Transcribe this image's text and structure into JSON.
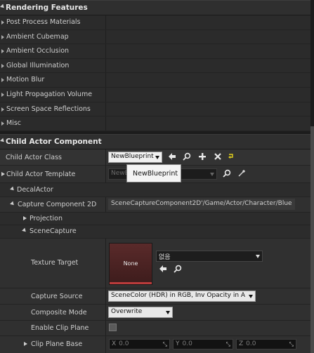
{
  "rendering_features": {
    "header": "Rendering Features",
    "items": [
      "Post Process Materials",
      "Ambient Cubemap",
      "Ambient Occlusion",
      "Global Illumination",
      "Motion Blur",
      "Light Propagation Volume",
      "Screen Space Reflections",
      "Misc"
    ]
  },
  "child_actor_component": {
    "header": "Child Actor Component",
    "child_actor_class": {
      "label": "Child Actor Class",
      "value": "NewBlueprint"
    },
    "child_actor_template": {
      "label": "Child Actor Template",
      "value": "NewB"
    },
    "tooltip": "NewBlueprint",
    "decal_actor": {
      "label": "DecalActor"
    },
    "capture_component": {
      "label": "Capture Component 2D",
      "value": "SceneCaptureComponent2D'/Game/Actor/Character/Blue"
    },
    "projection": {
      "label": "Projection"
    },
    "scene_capture": {
      "label": "SceneCapture"
    },
    "texture_target": {
      "label": "Texture Target",
      "thumbnail": "None",
      "value": "없음"
    },
    "capture_source": {
      "label": "Capture Source",
      "value": "SceneColor (HDR) in RGB, Inv Opacity in A"
    },
    "composite_mode": {
      "label": "Composite Mode",
      "value": "Overwrite"
    },
    "enable_clip_plane": {
      "label": "Enable Clip Plane",
      "checked": false
    },
    "clip_plane_base": {
      "label": "Clip Plane Base",
      "x_axis": "X",
      "x": "0.0",
      "y_axis": "Y",
      "y": "0.0",
      "z_axis": "Z",
      "z": "0.0"
    }
  }
}
